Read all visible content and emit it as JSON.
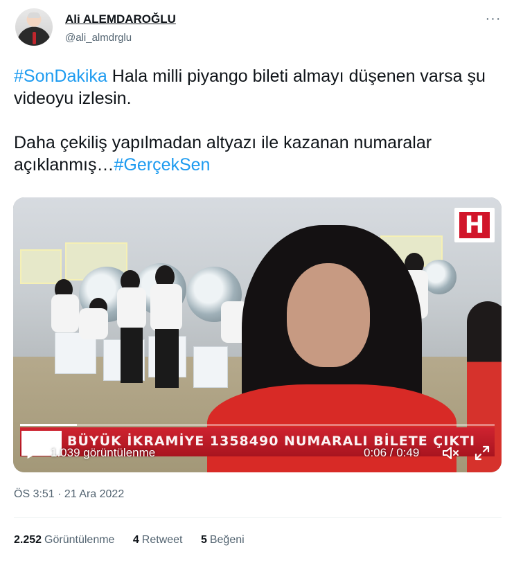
{
  "author": {
    "name": "Ali ALEMDAROĞLU",
    "handle": "@ali_almdrglu"
  },
  "tweet": {
    "line1_hashtag": "#SonDakika",
    "line1_text": " Hala milli piyango bileti almayı düşenen varsa şu videoyu izlesin.",
    "line2_text": "Daha çekiliş yapılmadan altyazı ile kazanan numaralar açıklanmış…",
    "line2_hashtag": "#GerçekSen"
  },
  "video": {
    "channel_logo": "H",
    "ticker_text": "BÜYÜK İKRAMİYE 1358490 NUMARALI BİLETE ÇIKTI",
    "views_label": "1.039 görüntülenme",
    "time_label": "0:06 / 0:49",
    "progress_fraction": 0.12
  },
  "timestamp": "ÖS 3:51 · 21 Ara 2022",
  "stats": {
    "views_count": "2.252",
    "views_label": "Görüntülenme",
    "retweets_count": "4",
    "retweets_label": "Retweet",
    "likes_count": "5",
    "likes_label": "Beğeni"
  },
  "icons": {
    "more": "more-dots-icon",
    "play": "play-icon",
    "volume": "volume-icon",
    "fullscreen": "fullscreen-icon"
  }
}
